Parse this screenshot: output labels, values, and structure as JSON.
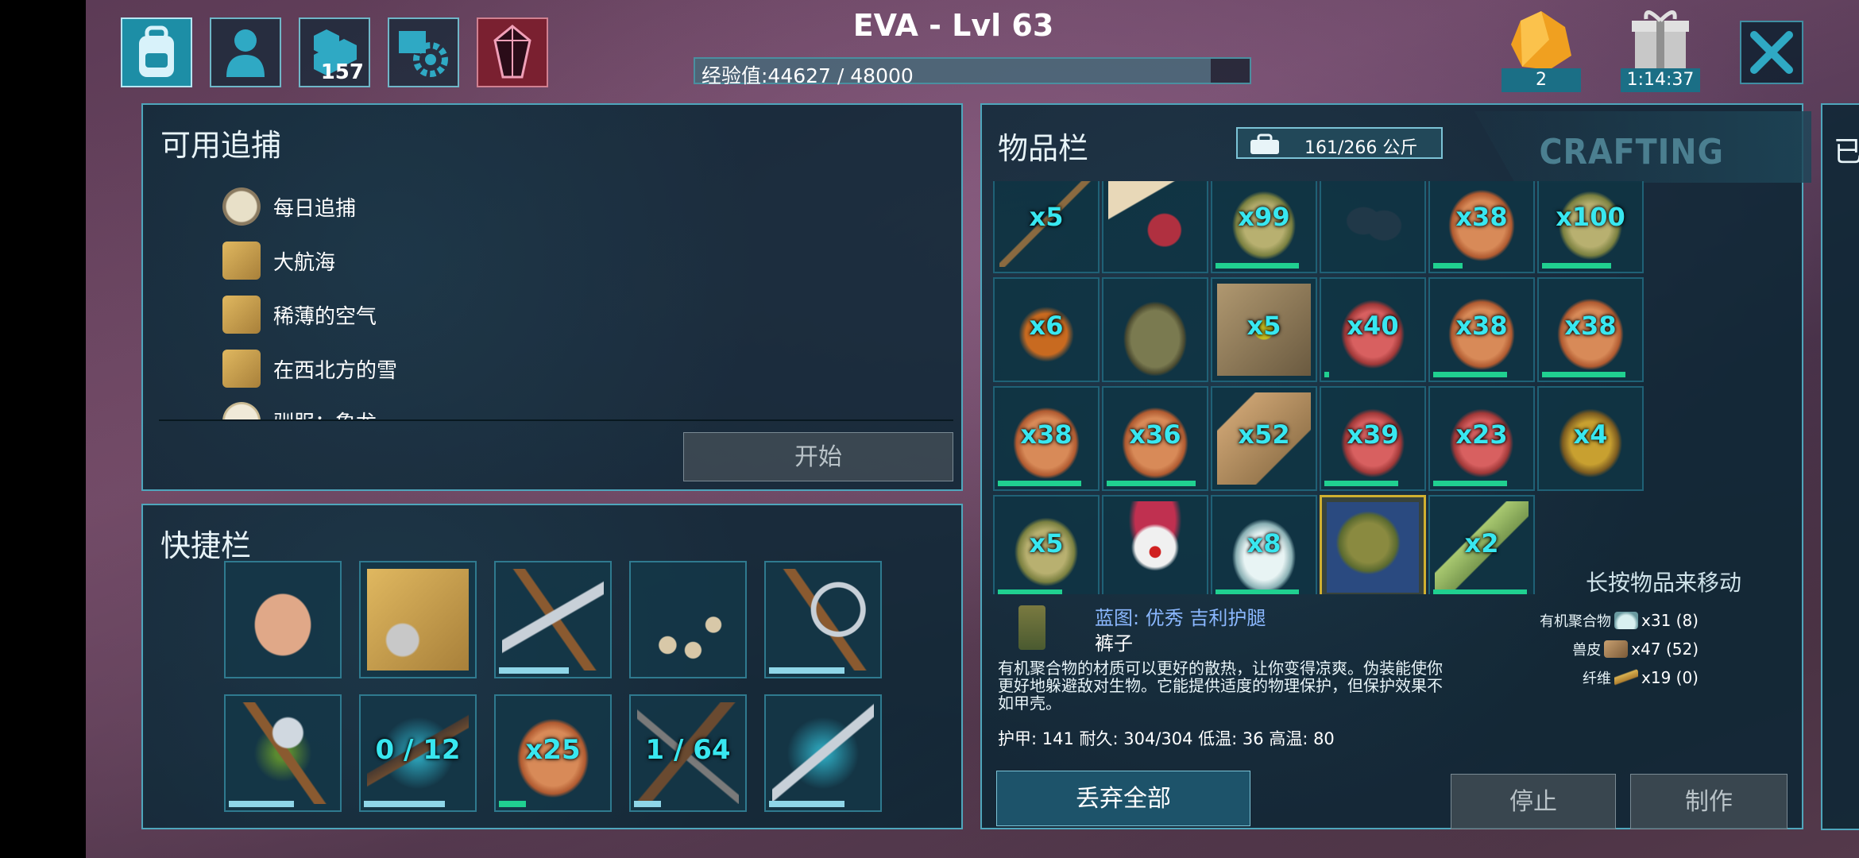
{
  "player": {
    "title": "EVA - Lvl 63",
    "xp_text": "经验值:44627 / 48000",
    "xp_fraction": 0.93
  },
  "top_tabs": [
    {
      "icon": "backpack-icon",
      "active": true
    },
    {
      "icon": "character-icon",
      "active": false
    },
    {
      "icon": "engrams-icon",
      "count": "157",
      "active": false
    },
    {
      "icon": "settings-book-icon",
      "active": false
    },
    {
      "icon": "crystal-icon",
      "active": false
    }
  ],
  "currency": {
    "amber_count": "2",
    "gift_timer": "1:14:37"
  },
  "hunts_panel": {
    "title": "可用追捕",
    "items": [
      "每日追捕",
      "大航海",
      "稀薄的空气",
      "在西北方的雪",
      "驯服：象龙"
    ],
    "start_label": "开始"
  },
  "hotbar": {
    "title": "快捷栏",
    "slots": [
      {
        "icon": "hand-icon",
        "qty": "",
        "durability": null
      },
      {
        "icon": "map-compass-icon",
        "qty": "",
        "durability": null
      },
      {
        "icon": "pickaxe-icon",
        "qty": "",
        "durability": 0.65
      },
      {
        "icon": "bola-icon",
        "qty": "",
        "durability": null
      },
      {
        "icon": "sickle-icon",
        "qty": "",
        "durability": 0.7
      },
      {
        "icon": "hatchet-icon",
        "qty": "",
        "durability": 0.6
      },
      {
        "icon": "shotgun-icon",
        "qty": "0 / 12",
        "durability": 0.75
      },
      {
        "icon": "cooked-meat-icon",
        "qty": "x25",
        "durability": 0.25,
        "green": true
      },
      {
        "icon": "crossbow-icon",
        "qty": "1 / 64",
        "durability": 0.25
      },
      {
        "icon": "machete-icon",
        "qty": "",
        "durability": 0.7
      }
    ]
  },
  "inventory": {
    "title": "物品栏",
    "weight": "161/266 公斤",
    "crafting_tab": "CRAFTING",
    "move_hint": "长按物品来移动",
    "slots": [
      {
        "icon": "spear-icon",
        "qty": "x5",
        "durability": null
      },
      {
        "icon": "note-bottle-icon",
        "qty": "",
        "durability": null
      },
      {
        "icon": "kibble-icon",
        "qty": "x99",
        "durability": 0.85
      },
      {
        "icon": "seeds-icon",
        "qty": "",
        "durability": null
      },
      {
        "icon": "cooked-meat-icon",
        "qty": "x38",
        "durability": 0.3
      },
      {
        "icon": "kibble-icon",
        "qty": "x100",
        "durability": 0.7
      },
      {
        "icon": "spice-icon",
        "qty": "x6",
        "durability": null
      },
      {
        "icon": "pith-helmet-icon",
        "qty": "",
        "durability": null
      },
      {
        "icon": "egg-kibble-icon",
        "qty": "x5",
        "durability": null
      },
      {
        "icon": "raw-meat-icon",
        "qty": "x40",
        "durability": 0.05
      },
      {
        "icon": "cooked-meat-icon",
        "qty": "x38",
        "durability": 0.75
      },
      {
        "icon": "cooked-meat-icon",
        "qty": "x38",
        "durability": 0.85
      },
      {
        "icon": "cooked-meat-icon",
        "qty": "x38",
        "durability": 0.85
      },
      {
        "icon": "cooked-meat-icon",
        "qty": "x36",
        "durability": 0.9
      },
      {
        "icon": "hide-icon",
        "qty": "x52",
        "durability": null
      },
      {
        "icon": "raw-meat-icon",
        "qty": "x39",
        "durability": 0.75
      },
      {
        "icon": "raw-meat-icon",
        "qty": "x23",
        "durability": 0.75
      },
      {
        "icon": "bowl-icon",
        "qty": "x4",
        "durability": null
      },
      {
        "icon": "kibble-icon",
        "qty": "x5",
        "durability": 0.65
      },
      {
        "icon": "clown-mask-icon",
        "qty": "",
        "durability": null
      },
      {
        "icon": "organic-polymer-icon",
        "qty": "x8",
        "durability": 0.85
      },
      {
        "icon": "ghillie-blueprint-icon",
        "qty": "",
        "durability": null,
        "selected": true
      },
      {
        "icon": "bottle-icon",
        "qty": "x2",
        "durability": 0.95
      }
    ],
    "detail": {
      "name": "蓝图: 优秀 吉利护腿",
      "type": "裤子",
      "description": "有机聚合物的材质可以更好的散热，让你变得凉爽。伪装能使你更好地躲避敌对生物。它能提供适度的物理保护，但保护效果不如甲壳。",
      "stats": "护甲: 141  耐久: 304/304  低温: 36  高温: 80",
      "resources": [
        {
          "name": "有机聚合物",
          "icon": "organic-polymer-icon",
          "amount": "x31 (8)"
        },
        {
          "name": "兽皮",
          "icon": "hide-icon",
          "amount": "x47 (52)"
        },
        {
          "name": "纤维",
          "icon": "fiber-icon",
          "amount": "x19 (0)"
        }
      ]
    },
    "drop_all_label": "丢弃全部",
    "stop_label": "停止",
    "craft_label": "制作"
  },
  "side_panel": {
    "label": "已"
  },
  "colors": {
    "accent": "#4fa6bc",
    "qty_text": "#38e7f0",
    "panel_bg": "#0c2634",
    "selected_border": "#d0b030"
  }
}
